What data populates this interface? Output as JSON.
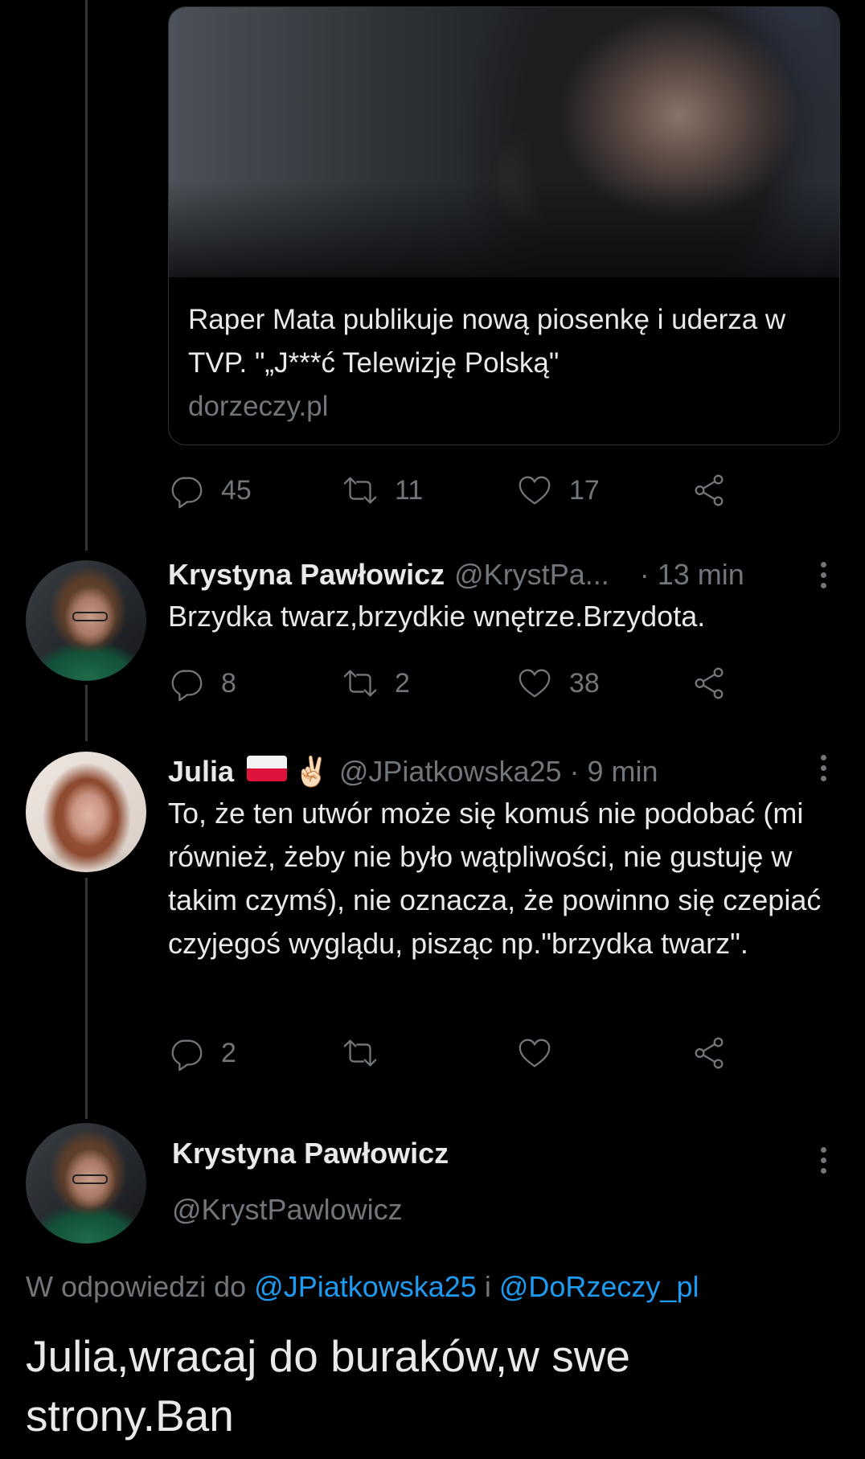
{
  "link_card": {
    "title": "Raper Mata publikuje nową piosenkę i uderza w TVP. \"„J***ć Telewizję Polską\"",
    "domain": "dorzeczy.pl"
  },
  "parent_actions": {
    "replies": "45",
    "retweets": "11",
    "likes": "17"
  },
  "reply1": {
    "name": "Krystyna Pawłowicz",
    "handle": "@KrystPa...",
    "time": "· 13 min",
    "text": "Brzydka twarz,brzydkie wnętrze.Brzydota.",
    "replies": "8",
    "retweets": "2",
    "likes": "38"
  },
  "reply2": {
    "name": "Julia",
    "emoji": "✌🏻",
    "handle": "@JPiatkowska25",
    "time": "· 9 min",
    "text": "To, że ten utwór może się komuś nie podobać (mi również, żeby nie było wątpliwości, nie gustuję w takim czymś), nie oznacza, że powinno się czepiać czyjegoś wyglądu, pisząc np.\"brzydka twarz\".",
    "replies": "2",
    "retweets": "",
    "likes": ""
  },
  "main_tweet": {
    "name": "Krystyna Pawłowicz",
    "handle": "@KrystPawlowicz",
    "reply_prefix": "W odpowiedzi do ",
    "reply_user1": "@JPiatkowska25",
    "reply_joiner": " i ",
    "reply_user2": "@DoRzeczy_pl",
    "text": "Julia,wracaj do buraków,w swe strony.Ban"
  },
  "icons": [
    "reply-icon",
    "retweet-icon",
    "like-icon",
    "share-icon",
    "more-icon",
    "flag-poland-icon"
  ],
  "colors": {
    "background": "#000000",
    "text": "#e7e9ea",
    "secondary": "#71767b",
    "link": "#1d9bf0"
  }
}
